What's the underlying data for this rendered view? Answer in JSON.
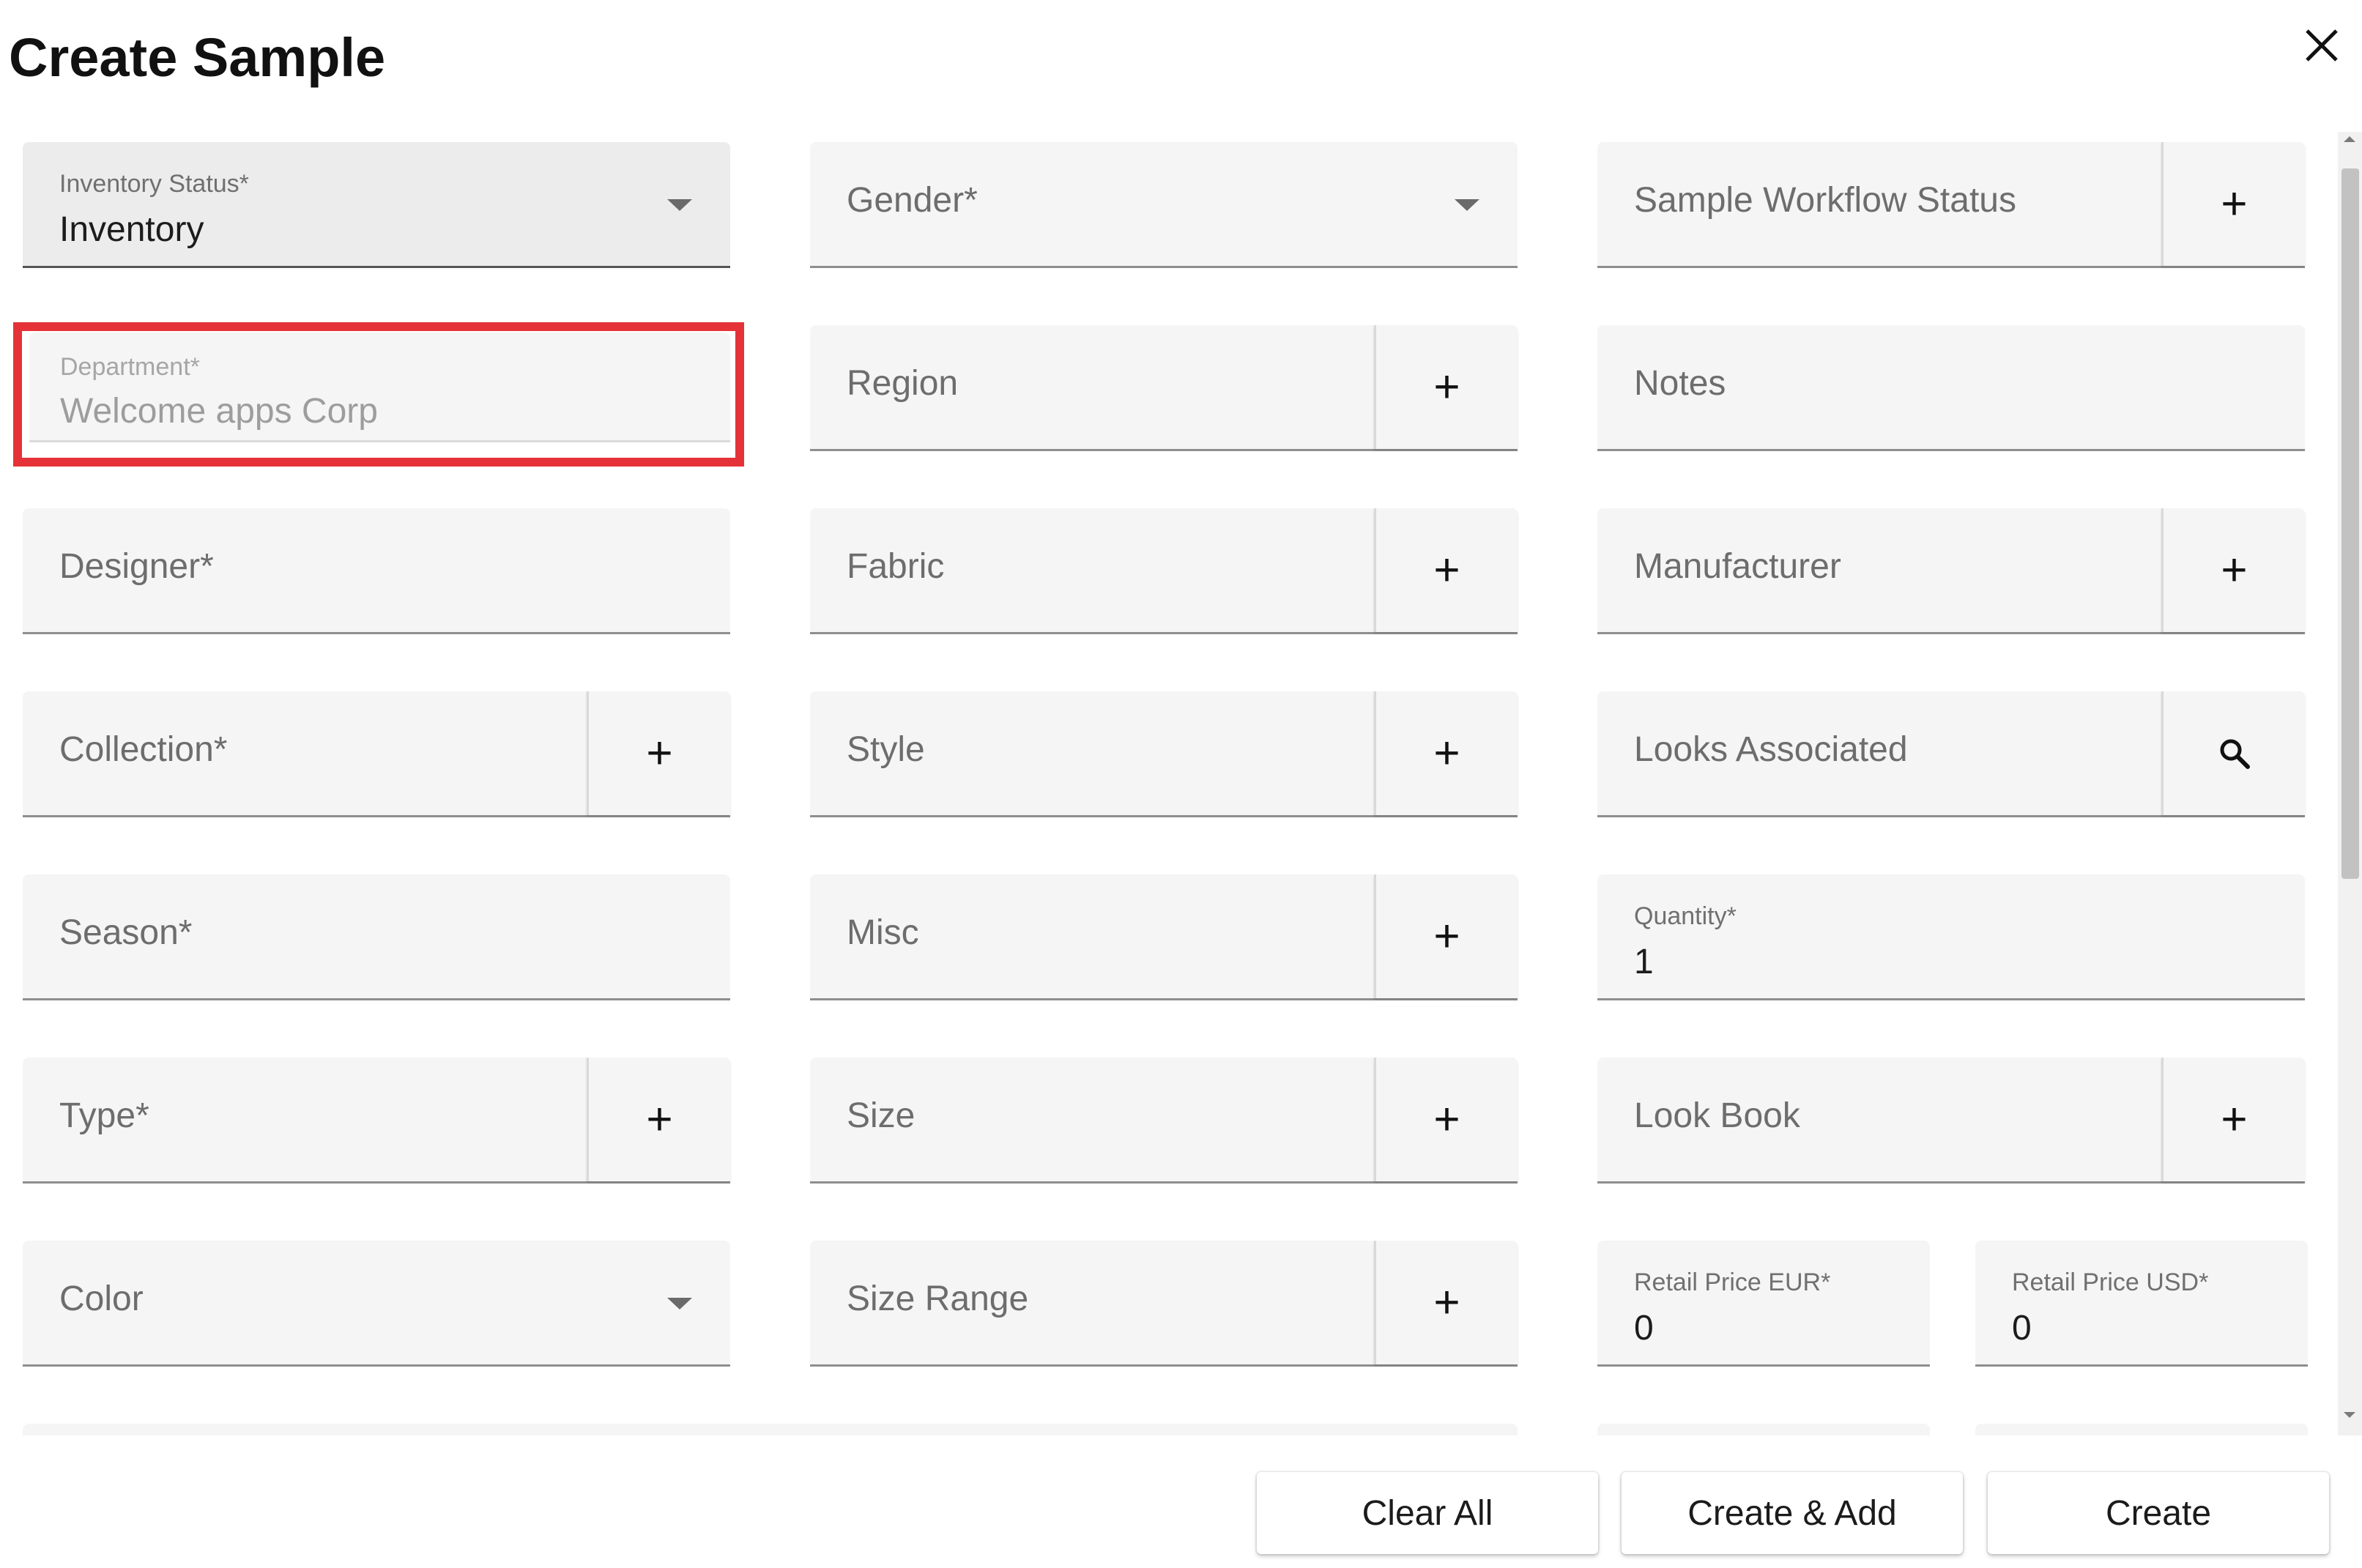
{
  "dialog": {
    "title": "Create Sample",
    "close_icon": "close-icon"
  },
  "fields": {
    "inventory_status": {
      "label": "Inventory Status*",
      "value": "Inventory"
    },
    "gender": {
      "placeholder": "Gender*"
    },
    "sample_workflow_status": {
      "placeholder": "Sample Workflow Status",
      "button": "+"
    },
    "department": {
      "label": "Department*",
      "value": "Welcome apps Corp"
    },
    "region": {
      "placeholder": "Region",
      "button": "+"
    },
    "notes": {
      "placeholder": "Notes"
    },
    "designer": {
      "placeholder": "Designer*"
    },
    "fabric": {
      "placeholder": "Fabric",
      "button": "+"
    },
    "manufacturer": {
      "placeholder": "Manufacturer",
      "button": "+"
    },
    "collection": {
      "placeholder": "Collection*",
      "button": "+"
    },
    "style": {
      "placeholder": "Style",
      "button": "+"
    },
    "looks_associated": {
      "placeholder": "Looks Associated",
      "icon": "search-icon"
    },
    "season": {
      "placeholder": "Season*"
    },
    "misc": {
      "placeholder": "Misc",
      "button": "+"
    },
    "quantity": {
      "label": "Quantity*",
      "value": "1"
    },
    "type": {
      "placeholder": "Type*",
      "button": "+"
    },
    "size": {
      "placeholder": "Size",
      "button": "+"
    },
    "look_book": {
      "placeholder": "Look Book",
      "button": "+"
    },
    "color": {
      "placeholder": "Color"
    },
    "size_range": {
      "placeholder": "Size Range",
      "button": "+"
    },
    "retail_price_eur": {
      "label": "Retail Price EUR*",
      "value": "0"
    },
    "retail_price_usd": {
      "label": "Retail Price USD*",
      "value": "0"
    }
  },
  "footer": {
    "clear_all": "Clear All",
    "create_and_add": "Create & Add",
    "create": "Create"
  },
  "colors": {
    "highlight": "#e53238",
    "field_bg": "#f5f5f5"
  }
}
